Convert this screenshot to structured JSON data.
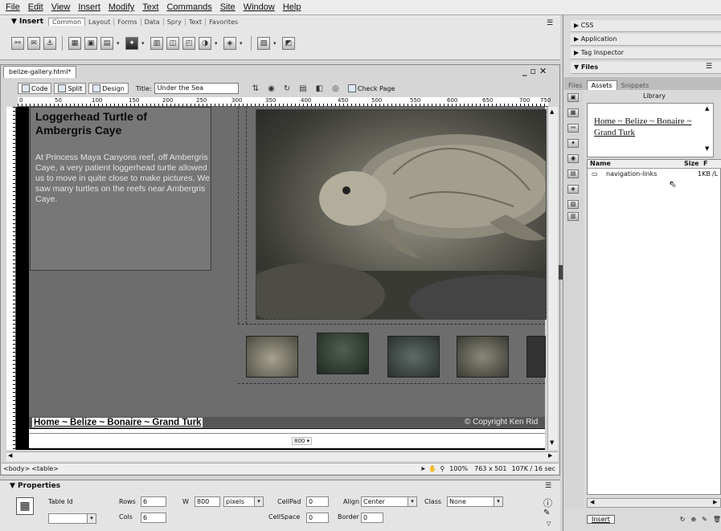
{
  "menu": [
    "File",
    "Edit",
    "View",
    "Insert",
    "Modify",
    "Text",
    "Commands",
    "Site",
    "Window",
    "Help"
  ],
  "insert_bar": {
    "label": "▼ Insert",
    "tabs": [
      "Common",
      "Layout",
      "Forms",
      "Data",
      "Spry",
      "Text",
      "Favorites"
    ],
    "active_tab": "Common"
  },
  "document": {
    "tab_title": "belize-gallery.html*",
    "view_buttons": [
      "Code",
      "Split",
      "Design"
    ],
    "title_label": "Title:",
    "title_value": "Under the Sea",
    "check_page": "Check Page",
    "ruler_numbers": [
      "0",
      "50",
      "100",
      "150",
      "200",
      "250",
      "300",
      "350",
      "400",
      "450",
      "500",
      "550",
      "600",
      "650",
      "700",
      "750"
    ],
    "heading": "Loggerhead Turtle of Ambergris Caye",
    "body_text": "At Princess Maya Canyons reef, off Ambergris Caye, a very patient loggerhead turtle allowed us to move in quite close to make pictures. We saw many turtles on the reefs near Ambergris Caye.",
    "footer_links": "Home ~ Belize ~ Bonaire ~ Grand Turk",
    "copyright": "© Copyright Ken Rid",
    "width_label": "800 ▾"
  },
  "statusbar": {
    "tag_body": "<body>",
    "tag_table": "<table>",
    "zoom": "100%",
    "dimensions": "763 x 501",
    "size_time": "107K / 16 sec"
  },
  "properties": {
    "title": "▼ Properties",
    "table_id_label": "Table Id",
    "rows_label": "Rows",
    "rows": "6",
    "cols_label": "Cols",
    "cols": "6",
    "w_label": "W",
    "w": "800",
    "w_unit": "pixels",
    "cellpad_label": "CellPad",
    "cellpad": "0",
    "cellspace_label": "CellSpace",
    "cellspace": "0",
    "align_label": "Align",
    "align": "Center",
    "border_label": "Border",
    "border": "0",
    "class_label": "Class",
    "class": "None"
  },
  "panels": {
    "css": "▶ CSS",
    "application": "▶ Application",
    "tag_inspector": "▶ Tag Inspector",
    "files": "▼ Files",
    "files_tabs": [
      "Files",
      "Assets",
      "Snippets"
    ],
    "active_files_tab": "Assets",
    "library": "Library",
    "preview_links": "Home ~ Belize ~ Bonaire ~ Grand Turk",
    "col_name": "Name",
    "col_size": "Size",
    "col_full": "F",
    "asset_name": "navigation-links",
    "asset_size": "1KB",
    "asset_path": "/L",
    "insert_button": "Insert"
  }
}
